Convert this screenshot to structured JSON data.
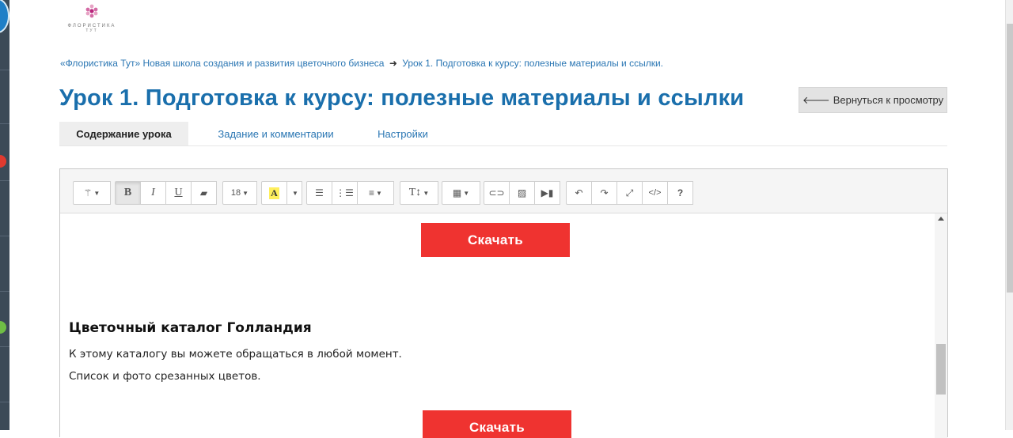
{
  "logo": {
    "line1": "ФЛОРИСТИКА",
    "line2": "ТУТ"
  },
  "breadcrumb": {
    "items": [
      "«Флористика Тут» Новая школа создания и развития цветочного бизнеса",
      "Урок 1. Подготовка к курсу: полезные материалы и ссылки."
    ],
    "separator": "➜"
  },
  "page": {
    "title": "Урок 1. Подготовка к курсу: полезные материалы и ссылки"
  },
  "back_button": {
    "icon": "arrow-left-icon",
    "label": "Вернуться к просмотру"
  },
  "tabs": [
    {
      "label": "Содержание урока",
      "active": true
    },
    {
      "label": "Задание и комментарии",
      "active": false
    },
    {
      "label": "Настройки",
      "active": false
    }
  ],
  "toolbar": {
    "font_size": "18",
    "bold": "B",
    "italic": "I",
    "underline": "U",
    "help": "?",
    "code": "</>",
    "text_style": "T↕"
  },
  "content": {
    "download_label": "Скачать",
    "catalog_heading": "Цветочный каталог Голландия",
    "para1": "К этому каталогу вы можете обращаться в любой момент.",
    "para2": "Список и фото срезанных цветов."
  },
  "colors": {
    "accent": "#1a6fac",
    "link": "#2a76b3",
    "download": "#ef3330",
    "sidebar": "#3c4a57"
  }
}
